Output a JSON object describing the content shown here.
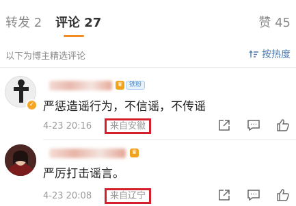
{
  "tabs": {
    "repost": "转发 2",
    "comment": "评论 27",
    "like": "赞 45"
  },
  "filter": {
    "hint": "以下为博主精选评论",
    "sort_label": "按热度"
  },
  "colors": {
    "accent_tab": "#f28b24",
    "link_blue": "#4a78b0",
    "highlight_box": "#d4202c"
  },
  "comments": [
    {
      "badge_fan": "铁粉",
      "text": "严惩造谣行为，不信谣，不传谣",
      "time": "4-23 20:16",
      "location": "来自安徽"
    },
    {
      "text": "严厉打击谣言。",
      "time": "4-23 20:08",
      "location": "来自辽宁"
    }
  ],
  "icons": {
    "share": "share-icon",
    "reply": "comment-icon",
    "like": "thumbs-up-icon",
    "sort": "sort-icon",
    "verified": "verified-badge-icon",
    "vip": "vip-crown-icon"
  }
}
